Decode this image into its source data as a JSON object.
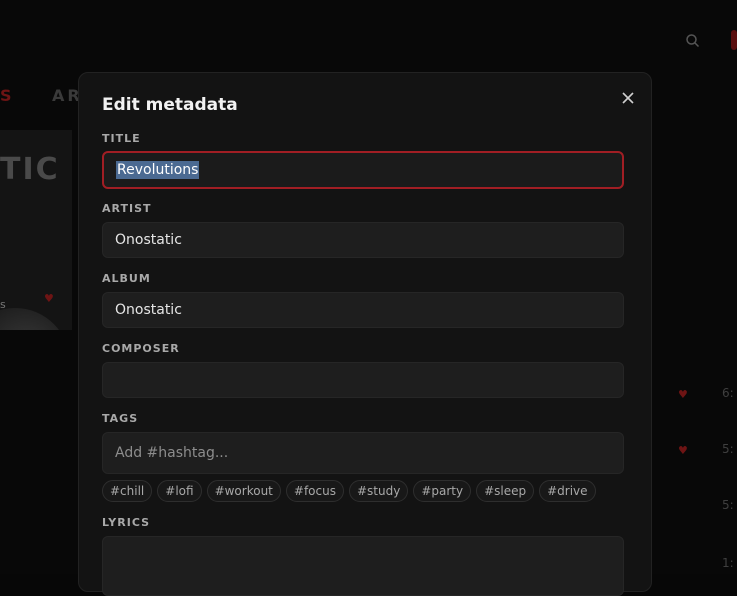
{
  "background": {
    "nav_left": "S",
    "nav_next": "AR",
    "album_text": "TIC",
    "album_sub": "s",
    "track_numbers": [
      "6:",
      "5:",
      "5:",
      "1:"
    ]
  },
  "modal": {
    "title": "Edit metadata",
    "fields": {
      "title": {
        "label": "TITLE",
        "value": "Revolutions"
      },
      "artist": {
        "label": "ARTIST",
        "value": "Onostatic"
      },
      "album": {
        "label": "ALBUM",
        "value": "Onostatic"
      },
      "composer": {
        "label": "COMPOSER",
        "value": ""
      },
      "tags": {
        "label": "TAGS",
        "placeholder": "Add #hashtag..."
      },
      "lyrics": {
        "label": "LYRICS",
        "value": ""
      }
    },
    "suggested_tags": [
      "#chill",
      "#lofi",
      "#workout",
      "#focus",
      "#study",
      "#party",
      "#sleep",
      "#drive"
    ]
  },
  "colors": {
    "accent": "#a11e24",
    "selection": "#4b6a92",
    "modal_bg": "#131313",
    "field_bg": "#1e1e1e"
  },
  "icons": {
    "close": "close-icon",
    "search": "search-icon",
    "heart": "heart-icon"
  }
}
